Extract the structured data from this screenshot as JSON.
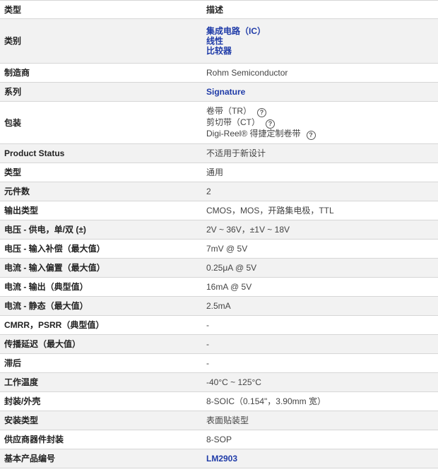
{
  "header": {
    "type": "类型",
    "desc": "描述"
  },
  "category": {
    "label": "类别",
    "links": [
      "集成电路（IC）",
      "线性",
      "比较器"
    ]
  },
  "manufacturer": {
    "label": "制造商",
    "value": "Rohm Semiconductor"
  },
  "series": {
    "label": "系列",
    "value": "Signature"
  },
  "packaging": {
    "label": "包装",
    "items": [
      "卷带（TR）",
      "剪切带（CT）",
      "Digi-Reel® 得捷定制卷带"
    ]
  },
  "rows": [
    {
      "label": "Product Status",
      "value": "不适用于新设计"
    },
    {
      "label": "类型",
      "value": "通用"
    },
    {
      "label": "元件数",
      "value": "2"
    },
    {
      "label": "输出类型",
      "value": "CMOS，MOS，开路集电极，TTL"
    },
    {
      "label": "电压 - 供电，单/双 (±)",
      "value": "2V ~ 36V，±1V ~ 18V"
    },
    {
      "label": "电压 - 输入补偿（最大值）",
      "value": "7mV @ 5V"
    },
    {
      "label": "电流 - 输入偏置（最大值）",
      "value": "0.25μA @ 5V"
    },
    {
      "label": "电流 - 输出（典型值）",
      "value": "16mA @ 5V"
    },
    {
      "label": "电流 - 静态（最大值）",
      "value": "2.5mA"
    },
    {
      "label": "CMRR，PSRR（典型值）",
      "value": "-"
    },
    {
      "label": "传播延迟（最大值）",
      "value": "-"
    },
    {
      "label": "滞后",
      "value": "-"
    },
    {
      "label": "工作温度",
      "value": "-40°C ~ 125°C"
    },
    {
      "label": "封装/外壳",
      "value": "8-SOIC（0.154\"，3.90mm 宽）"
    },
    {
      "label": "安装类型",
      "value": "表面贴装型"
    },
    {
      "label": "供应商器件封装",
      "value": "8-SOP"
    }
  ],
  "base_product": {
    "label": "基本产品编号",
    "value": "LM2903"
  },
  "icons": {
    "help": "question-circle-icon"
  },
  "colors": {
    "link": "#1f3ba8",
    "row_alt": "#f2f2f2",
    "border": "#d6d6d6"
  }
}
